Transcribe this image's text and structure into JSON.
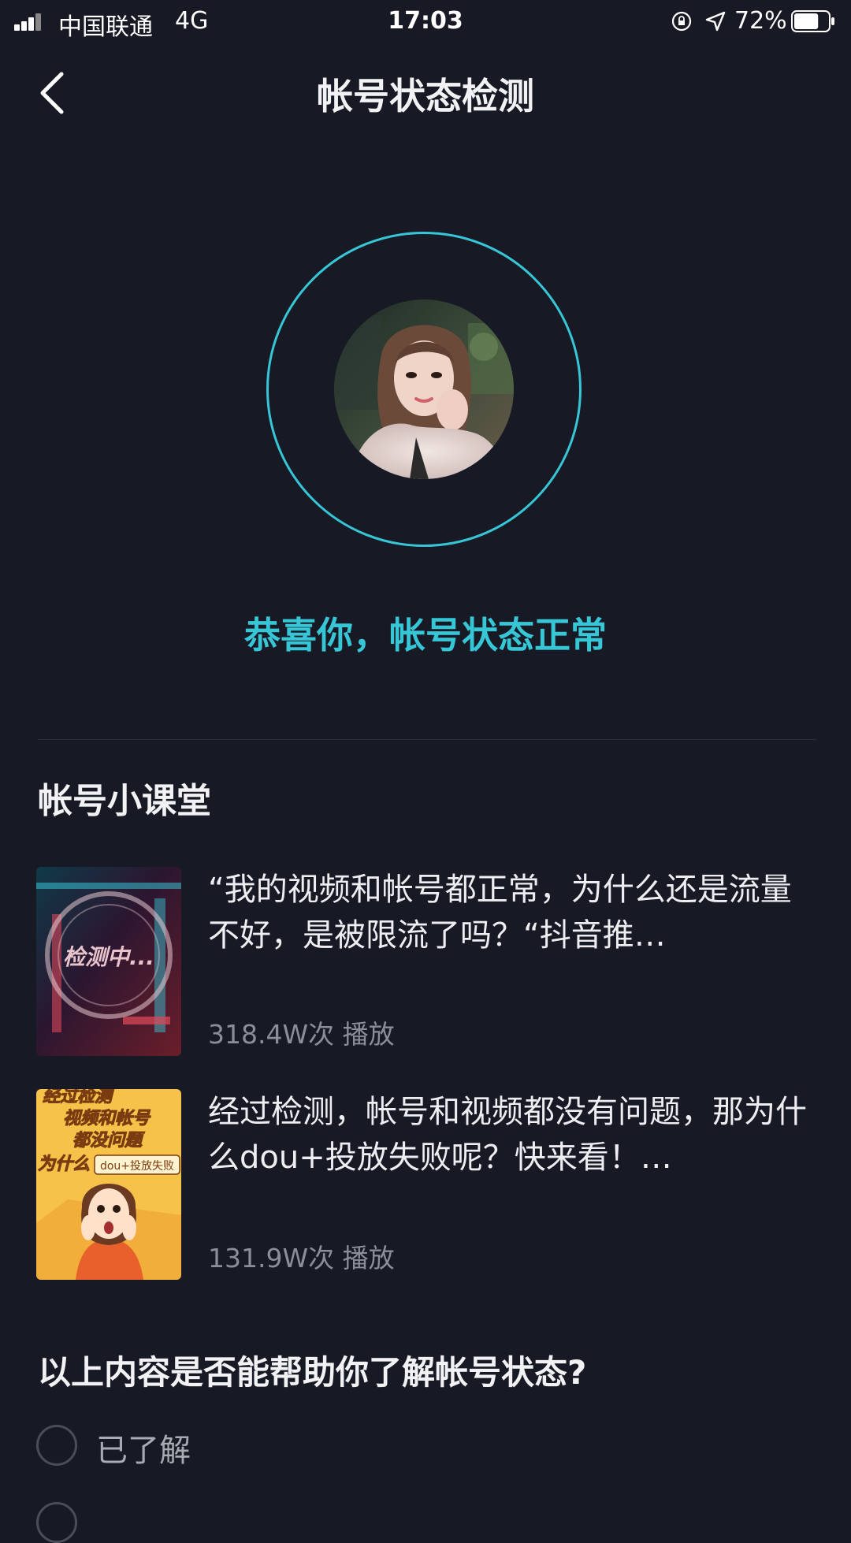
{
  "status_bar": {
    "carrier": "中国联通",
    "network": "4G",
    "time": "17:03",
    "battery": "72%",
    "battery_level": 0.72
  },
  "header": {
    "title": "帐号状态检测",
    "back_icon": "chevron-left-icon"
  },
  "detection": {
    "ring_color": "#36c6d6",
    "message": "恭喜你，帐号状态正常"
  },
  "lessons": {
    "section_title": "帐号小课堂",
    "items": [
      {
        "title": "“我的视频和帐号都正常，为什么还是流量不好，是被限流了吗？“抖音推…",
        "plays": "318.4W次 播放",
        "thumb_text": "检测中..."
      },
      {
        "title": "经过检测，帐号和视频都没有问题，那为什么dou+投放失败呢？快来看！…",
        "plays": "131.9W次 播放",
        "thumb_lines": [
          "经过检测",
          "视频和帐号",
          "都没问题",
          "为什么"
        ],
        "thumb_badge": "dou+投放失败"
      }
    ]
  },
  "feedback": {
    "question": "以上内容是否能帮助你了解帐号状态?",
    "options": [
      "已了解"
    ]
  },
  "colors": {
    "background": "#171925",
    "accent": "#36c6d6",
    "muted_text": "#8b8d98"
  }
}
